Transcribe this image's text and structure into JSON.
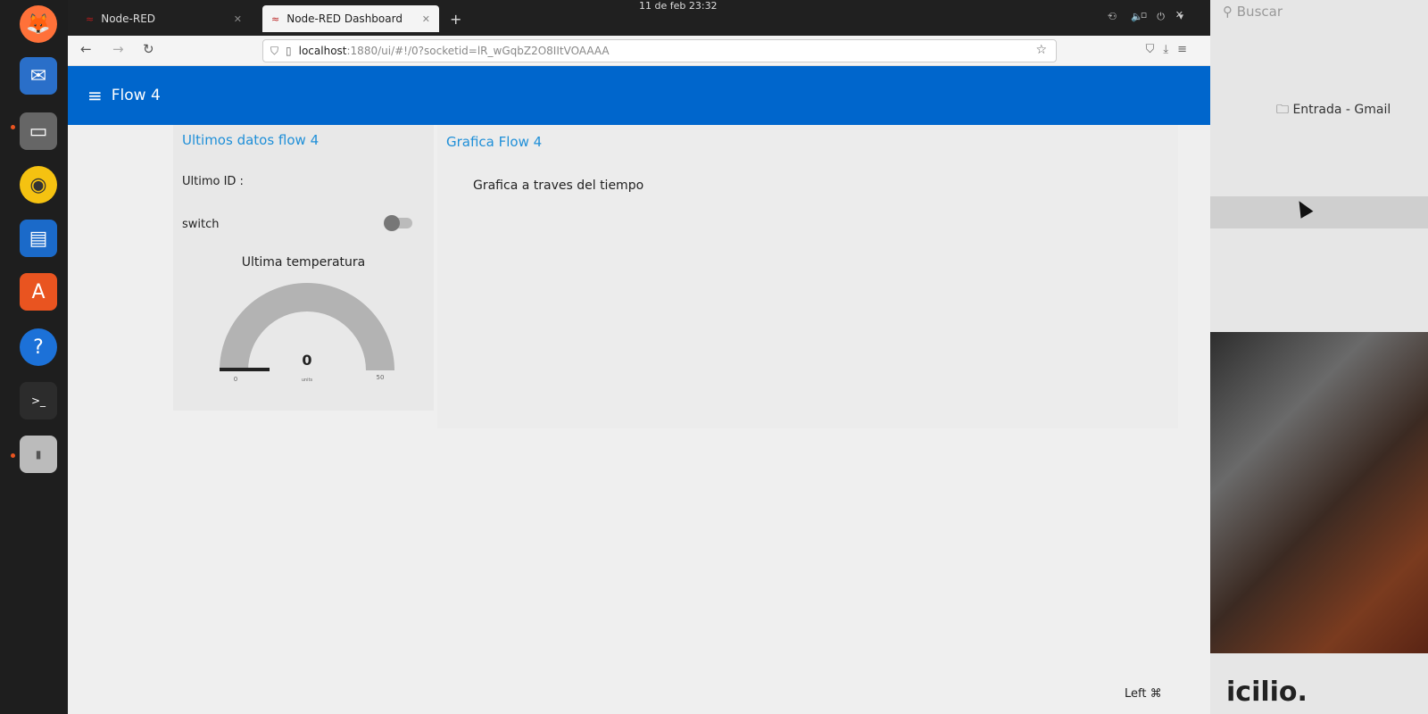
{
  "os": {
    "clock": "11 de feb  23:32"
  },
  "browser": {
    "tabs": [
      {
        "label": "Node-RED",
        "active": false
      },
      {
        "label": "Node-RED Dashboard",
        "active": true
      }
    ],
    "url_host": "localhost",
    "url_path": ":1880/ui/#!/0?socketid=lR_wGqbZ2O8IItVOAAAA"
  },
  "dashboard": {
    "title": "Flow 4",
    "groups": {
      "left": {
        "title": "Ultimos datos flow 4",
        "last_id_label": "Ultimo ID :",
        "switch_label": "switch",
        "switch_on": false,
        "gauge": {
          "title": "Ultima temperatura",
          "value": "0",
          "units": "units",
          "min": "0",
          "max": "50"
        }
      },
      "right": {
        "title": "Grafica Flow 4",
        "chart_title": "Grafica a traves del tiempo"
      }
    }
  },
  "background_window": {
    "search_placeholder": "Buscar",
    "bookmark": "Entrada - Gmail",
    "footer_word": "icilio.",
    "status_text": "Left ⌘"
  },
  "colors": {
    "header": "#0066cc",
    "group_title": "#1f8fd8",
    "gauge_track": "#b3b3b3"
  }
}
